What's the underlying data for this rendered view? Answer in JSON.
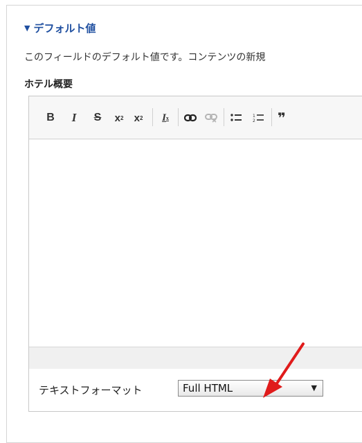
{
  "details": {
    "summary": "デフォルト値",
    "description": "このフィールドのデフォルト値です。コンテンツの新規"
  },
  "field": {
    "label": "ホテル概要"
  },
  "toolbar": {
    "buttons": [
      {
        "name": "bold",
        "glyph": "B"
      },
      {
        "name": "italic",
        "glyph": "I"
      },
      {
        "name": "strikethrough",
        "glyph": "S"
      },
      {
        "name": "superscript",
        "glyph": "x²"
      },
      {
        "name": "subscript",
        "glyph": "x₂"
      },
      {
        "name": "remove-format",
        "glyph": "Ix"
      },
      {
        "name": "link",
        "glyph": "link"
      },
      {
        "name": "unlink",
        "glyph": "unlink"
      },
      {
        "name": "bulleted-list",
        "glyph": "bullets"
      },
      {
        "name": "numbered-list",
        "glyph": "numbers"
      },
      {
        "name": "blockquote",
        "glyph": "❞"
      }
    ]
  },
  "format": {
    "label": "テキストフォーマット",
    "selected": "Full HTML"
  },
  "colors": {
    "summary": "#1f4fa0",
    "annotation_arrow": "#e01b1b"
  }
}
